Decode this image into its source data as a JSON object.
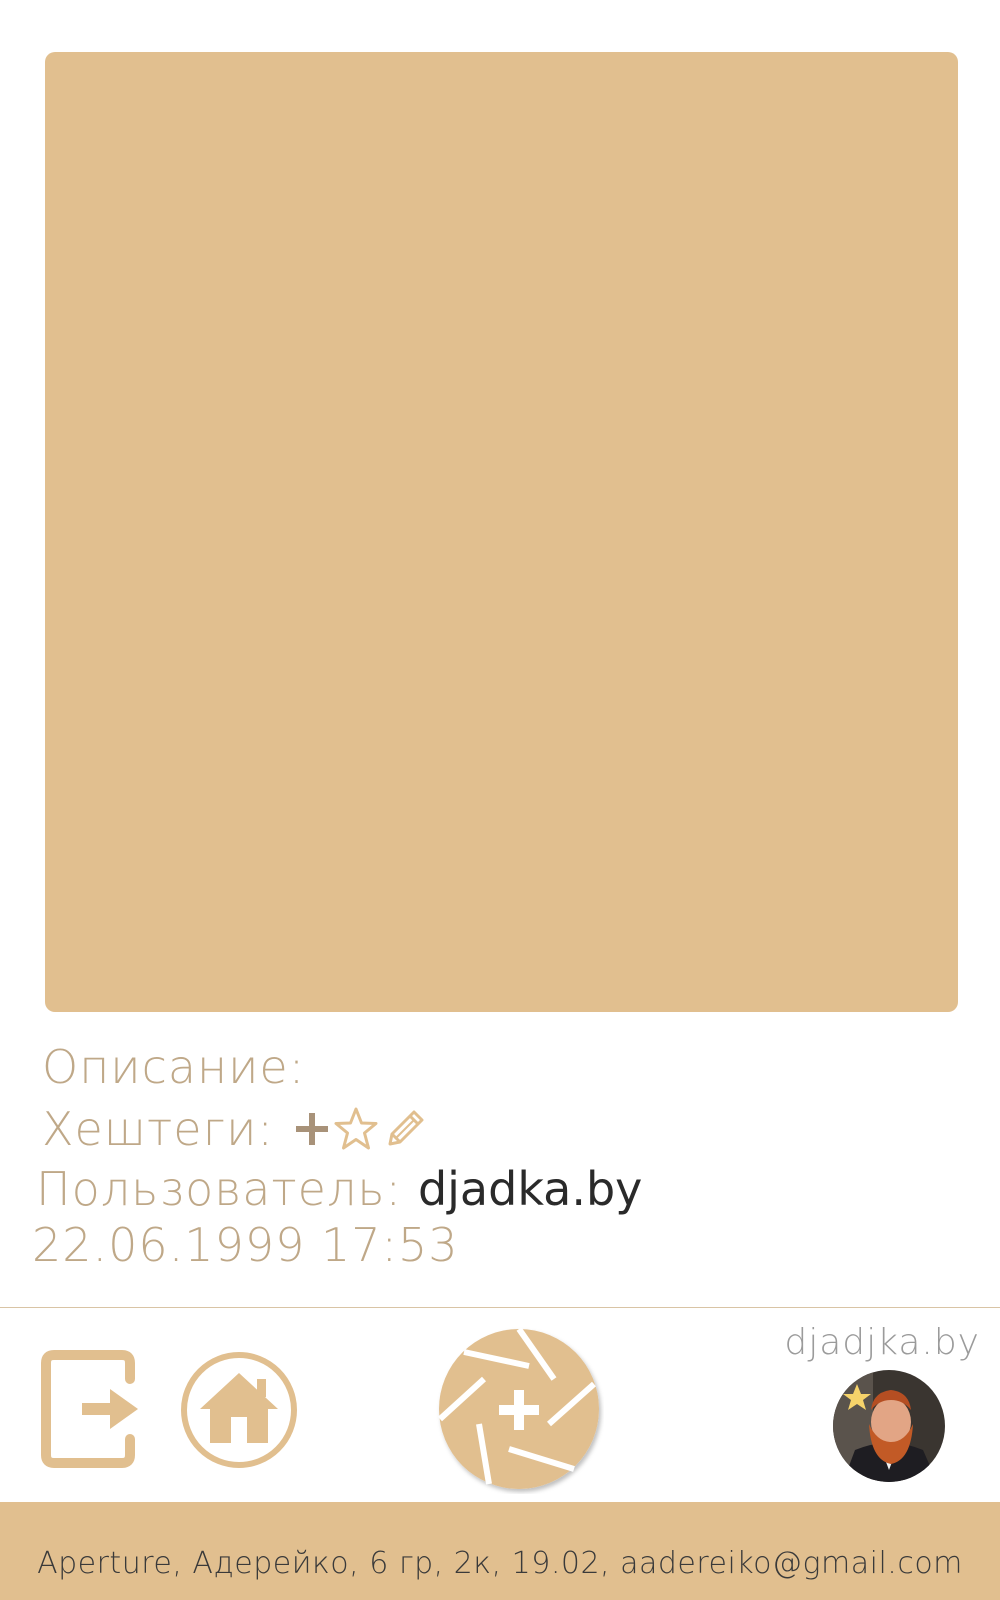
{
  "photo": {
    "color": "#e1bf8f"
  },
  "details": {
    "description_label": "Описание:",
    "hashtags_label": "Хештеги:",
    "user_label": "Пользователь:",
    "user_value": "djadka.by",
    "datetime": "22.06.1999 17:53",
    "hashtag_icons": [
      "plus-icon",
      "star-icon",
      "pencil-icon"
    ]
  },
  "nav": {
    "icons": [
      "exit-icon",
      "home-icon",
      "aperture-add-icon"
    ],
    "brand": "djadjka.by",
    "avatar": "user-avatar"
  },
  "footer": {
    "text": "Aperture, Адерейко, 6 гр, 2к, 19.02, aadereiko@gmail.com"
  },
  "colors": {
    "accent": "#e1bf8f",
    "label": "#bfa888",
    "value": "#2a2a2a"
  }
}
